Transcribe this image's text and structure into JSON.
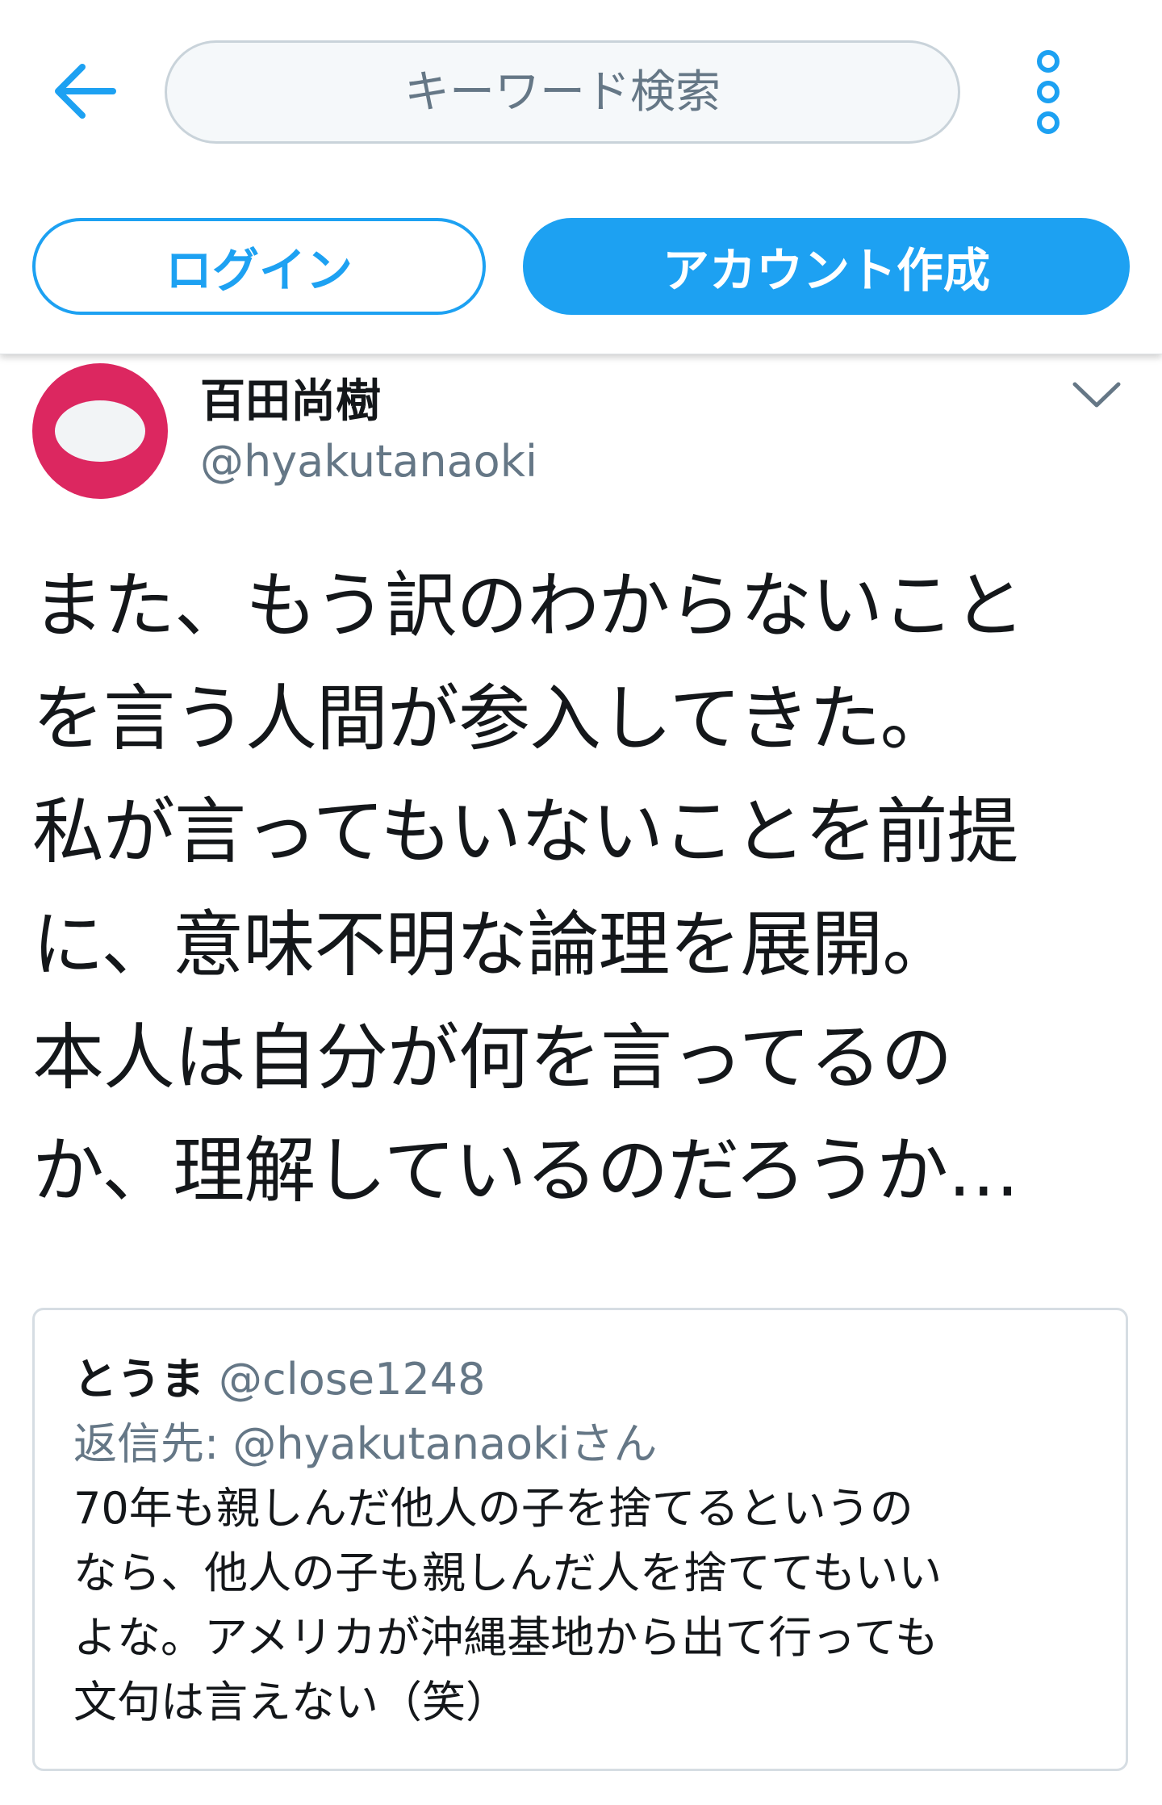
{
  "header": {
    "search_placeholder": "キーワード検索",
    "login_label": "ログイン",
    "signup_label": "アカウント作成"
  },
  "tweet": {
    "display_name": "百田尚樹",
    "handle": "@hyakutanaoki",
    "text_lines": [
      "また、もう訳のわからないこと",
      "を言う人間が参入してきた。",
      "私が言ってもいないことを前提",
      "に、意味不明な論理を展開。",
      "本人は自分が何を言ってるの",
      "か、理解しているのだろうか…"
    ]
  },
  "quoted_tweet": {
    "display_name": "とうま",
    "handle": "@close1248",
    "reply_prefix": "返信先:",
    "reply_to": "@hyakutanaokiさん",
    "text_lines": [
      "70年も親しんだ他人の子を捨てるというの",
      "なら、他人の子も親しんだ人を捨ててもいい",
      "よな。アメリカが沖縄基地から出て行っても",
      "文句は言えない（笑）"
    ]
  },
  "colors": {
    "accent": "#1da1f2",
    "avatar_bg": "#dc2760",
    "secondary_text": "#657786",
    "primary_text": "#14171a"
  },
  "icons": {
    "back": "arrow-left-icon",
    "more": "vertical-dots-icon",
    "caret": "chevron-down-icon"
  }
}
